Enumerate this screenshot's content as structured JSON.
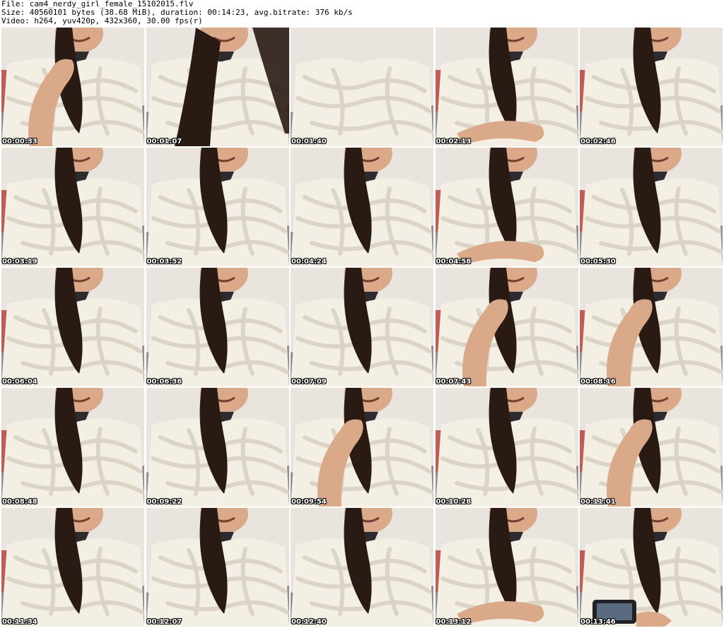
{
  "header": {
    "file_line": "File: cam4_nerdy_girl_female_15102015.flv",
    "size_line": "Size: 40560101 bytes (38.68 MiB), duration: 00:14:23, avg.bitrate: 376 kb/s",
    "video_line": "Video: h264, yuv420p, 432x360, 30.00 fps(r)"
  },
  "thumbnails": [
    {
      "time": "00:00:33",
      "scene": "hand-at-chin"
    },
    {
      "time": "00:01:07",
      "scene": "close-face-hair"
    },
    {
      "time": "00:01:40",
      "scene": "blanket-closeup"
    },
    {
      "time": "00:02:13",
      "scene": "arms-crossed"
    },
    {
      "time": "00:02:46",
      "scene": "blanket-wrapped"
    },
    {
      "time": "00:03:19",
      "scene": "blanket-wrapped"
    },
    {
      "time": "00:03:52",
      "scene": "hair-over-shoulder"
    },
    {
      "time": "00:04:24",
      "scene": "hair-over-shoulder"
    },
    {
      "time": "00:04:58",
      "scene": "hands-in-lap"
    },
    {
      "time": "00:05:30",
      "scene": "hair-over-shoulder"
    },
    {
      "time": "00:06:04",
      "scene": "hair-over-shoulder"
    },
    {
      "time": "00:06:36",
      "scene": "hair-over-shoulder"
    },
    {
      "time": "00:07:09",
      "scene": "hair-over-shoulder"
    },
    {
      "time": "00:07:43",
      "scene": "hand-at-chin"
    },
    {
      "time": "00:08:16",
      "scene": "hand-at-chin"
    },
    {
      "time": "00:08:48",
      "scene": "hair-over-shoulder"
    },
    {
      "time": "00:09:22",
      "scene": "hair-over-shoulder"
    },
    {
      "time": "00:09:54",
      "scene": "hand-at-chin"
    },
    {
      "time": "00:10:28",
      "scene": "hair-over-shoulder"
    },
    {
      "time": "00:11:01",
      "scene": "hand-at-chin"
    },
    {
      "time": "00:11:34",
      "scene": "hair-over-shoulder"
    },
    {
      "time": "00:12:07",
      "scene": "hair-over-shoulder"
    },
    {
      "time": "00:12:40",
      "scene": "hair-over-shoulder"
    },
    {
      "time": "00:13:12",
      "scene": "hands-in-lap"
    },
    {
      "time": "00:13:46",
      "scene": "holding-phone"
    }
  ],
  "colors": {
    "wall": "#e9e4de",
    "blanket": "#f4efe4",
    "blanket_shadow": "#d9d1c3",
    "hair": "#2a1a14",
    "skin": "#d9a98a",
    "sleeve": "#8e9095",
    "couch_red": "#b9473e",
    "stamp_text": "#ffffff"
  }
}
